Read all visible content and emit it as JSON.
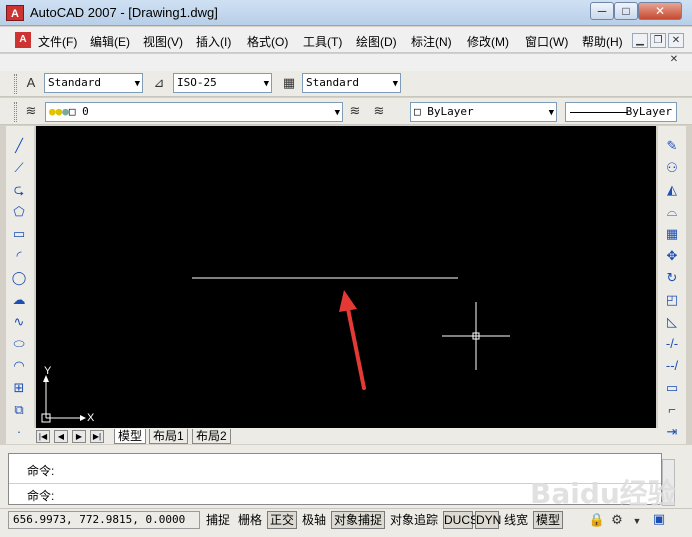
{
  "window": {
    "title": "AutoCAD 2007 - [Drawing1.dwg]",
    "minimize_glyph": "─",
    "maximize_glyph": "□",
    "close_glyph": "✕"
  },
  "menu": {
    "items": [
      "文件(F)",
      "编辑(E)",
      "视图(V)",
      "插入(I)",
      "格式(O)",
      "工具(T)",
      "绘图(D)",
      "标注(N)",
      "修改(M)",
      "窗口(W)",
      "帮助(H)"
    ]
  },
  "styles_toolbar": {
    "text_style": "Standard",
    "dim_style": "ISO-25",
    "table_style": "Standard"
  },
  "layers_toolbar": {
    "current_layer": "0"
  },
  "properties_toolbar": {
    "color": "ByLayer",
    "linetype": "ByLayer"
  },
  "tabs": {
    "items": [
      "模型",
      "布局1",
      "布局2"
    ],
    "active": "模型"
  },
  "command": {
    "line1": "命令:",
    "line2": "命令:"
  },
  "status": {
    "coordinates": "656.9973, 772.9815, 0.0000",
    "buttons": [
      "捕捉",
      "栅格",
      "正交",
      "极轴",
      "对象捕捉",
      "对象追踪",
      "DUCS",
      "DYN",
      "线宽",
      "模型"
    ],
    "on_buttons": [
      "正交",
      "对象捕捉",
      "DUCS",
      "DYN",
      "模型"
    ]
  },
  "canvas": {
    "background": "#000000",
    "line_color": "#ffffff",
    "arrow_color": "#e53935",
    "ucs_y_label": "Y",
    "ucs_x_label": "X"
  },
  "watermark": "Baidu经验"
}
